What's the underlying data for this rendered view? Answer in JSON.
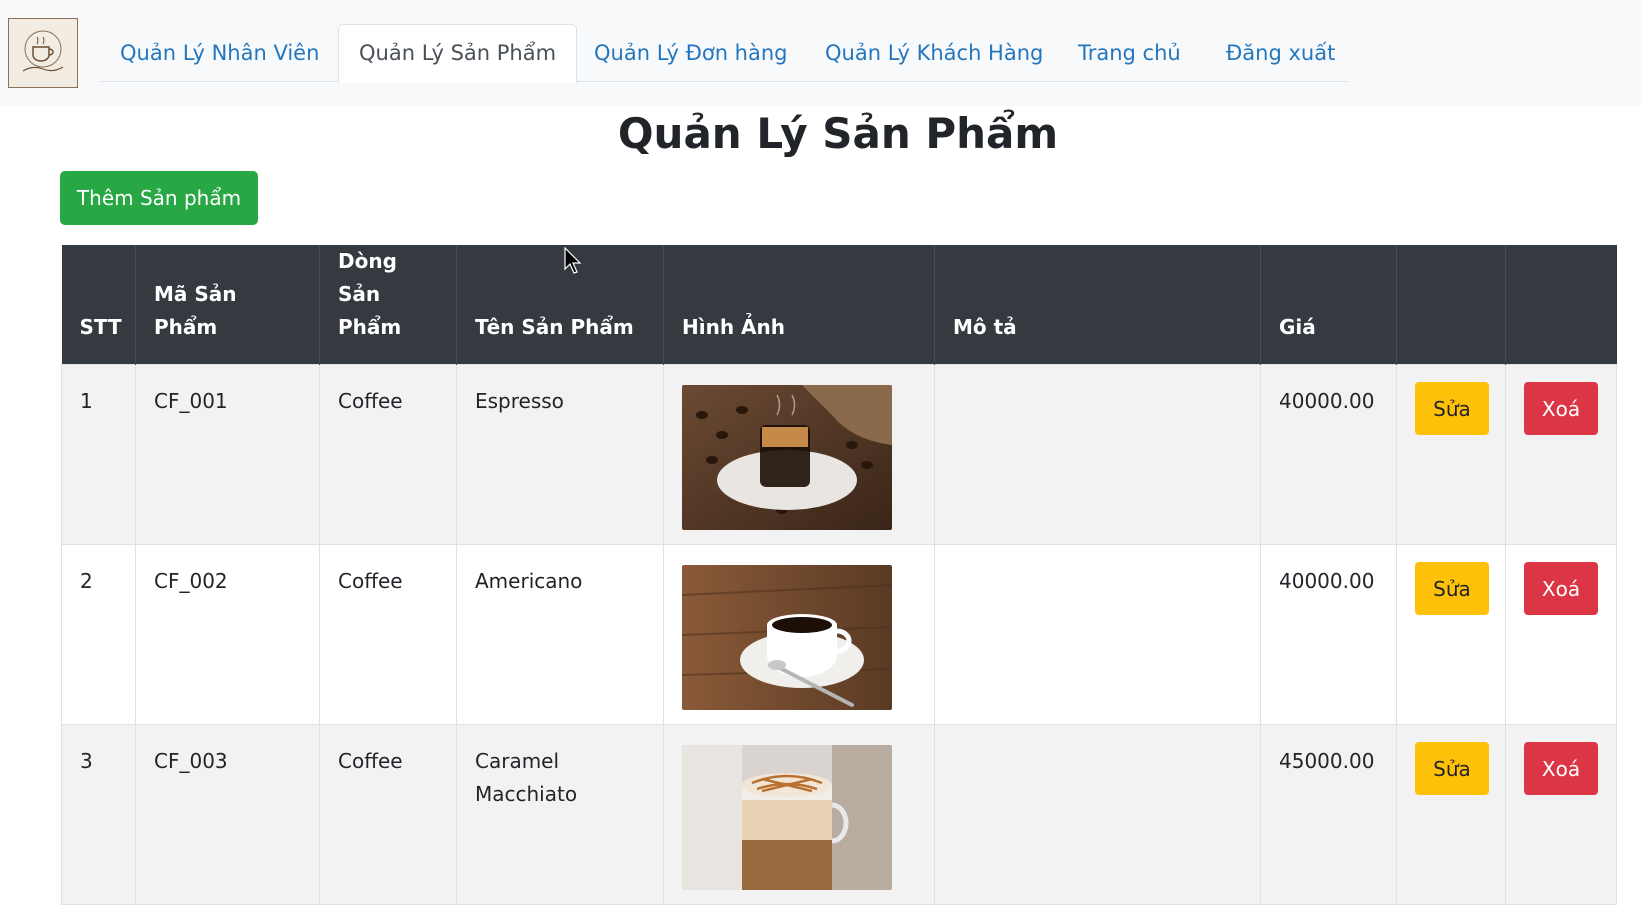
{
  "logo": {
    "alt_text": "The Coffee Shop"
  },
  "nav": {
    "tabs": [
      {
        "label": "Quản Lý Nhân Viên",
        "active": false
      },
      {
        "label": "Quản Lý Sản Phẩm",
        "active": true
      },
      {
        "label": "Quản Lý Đơn hàng",
        "active": false
      },
      {
        "label": "Quản Lý Khách Hàng",
        "active": false
      },
      {
        "label": "Trang chủ",
        "active": false
      },
      {
        "label": "Đăng xuất",
        "active": false
      }
    ]
  },
  "page": {
    "title": "Quản Lý Sản Phẩm",
    "add_button_label": "Thêm Sản phẩm"
  },
  "table": {
    "headers": [
      "STT",
      "Mã Sản Phẩm",
      "Dòng Sản Phẩm",
      "Tên Sản Phẩm",
      "Hình Ảnh",
      "Mô tả",
      "Giá",
      "",
      ""
    ],
    "rows": [
      {
        "stt": "1",
        "code": "CF_001",
        "category": "Coffee",
        "name": "Espresso",
        "image": "espresso-photo",
        "description": "",
        "price": "40000.00",
        "edit_label": "Sửa",
        "delete_label": "Xoá"
      },
      {
        "stt": "2",
        "code": "CF_002",
        "category": "Coffee",
        "name": "Americano",
        "image": "americano-photo",
        "description": "",
        "price": "40000.00",
        "edit_label": "Sửa",
        "delete_label": "Xoá"
      },
      {
        "stt": "3",
        "code": "CF_003",
        "category": "Coffee",
        "name": "Caramel Macchiato",
        "image": "caramel-macchiato-photo",
        "description": "",
        "price": "45000.00",
        "edit_label": "Sửa",
        "delete_label": "Xoá"
      }
    ]
  },
  "colors": {
    "nav_link": "#2477bf",
    "header_bg": "#343a40",
    "add_button": "#28a745",
    "edit_button": "#ffc107",
    "delete_button": "#dc3545"
  }
}
